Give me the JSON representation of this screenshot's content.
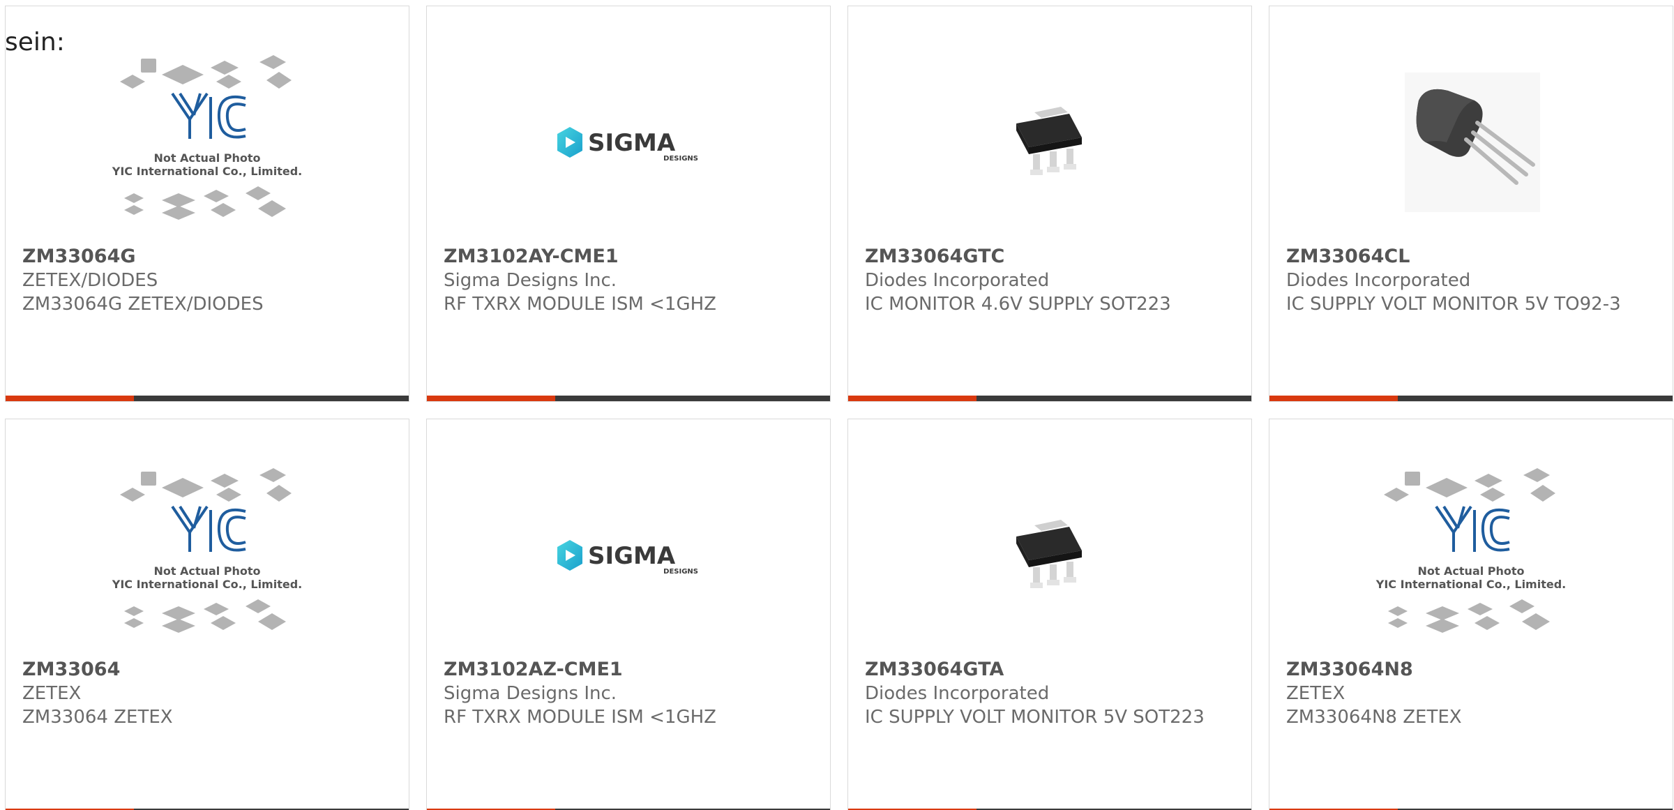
{
  "lead_text": "sein:",
  "accent_color": "#d9390f",
  "cards": [
    {
      "pn": "ZM33064G",
      "mfr": "ZETEX/DIODES",
      "desc": "ZM33064G ZETEX/DIODES",
      "image": "yic-placeholder",
      "img_line1": "Not Actual Photo",
      "img_line2": "YIC International Co., Limited."
    },
    {
      "pn": "ZM3102AY-CME1",
      "mfr": "Sigma Designs Inc.",
      "desc": "RF TXRX MODULE ISM <1GHZ",
      "image": "sigma-logo",
      "logo_main": "SIGMA",
      "logo_sub": "DESIGNS"
    },
    {
      "pn": "ZM33064GTC",
      "mfr": "Diodes Incorporated",
      "desc": "IC MONITOR 4.6V SUPPLY SOT223",
      "image": "sot223-chip"
    },
    {
      "pn": "ZM33064CL",
      "mfr": "Diodes Incorporated",
      "desc": "IC SUPPLY VOLT MONITOR 5V TO92-3",
      "image": "to92-transistor"
    },
    {
      "pn": "ZM33064",
      "mfr": "ZETEX",
      "desc": "ZM33064 ZETEX",
      "image": "yic-placeholder",
      "img_line1": "Not Actual Photo",
      "img_line2": "YIC International Co., Limited."
    },
    {
      "pn": "ZM3102AZ-CME1",
      "mfr": "Sigma Designs Inc.",
      "desc": "RF TXRX MODULE ISM <1GHZ",
      "image": "sigma-logo",
      "logo_main": "SIGMA",
      "logo_sub": "DESIGNS"
    },
    {
      "pn": "ZM33064GTA",
      "mfr": "Diodes Incorporated",
      "desc": "IC SUPPLY VOLT MONITOR 5V SOT223",
      "image": "sot223-chip"
    },
    {
      "pn": "ZM33064N8",
      "mfr": "ZETEX",
      "desc": "ZM33064N8 ZETEX",
      "image": "yic-placeholder",
      "img_line1": "Not Actual Photo",
      "img_line2": "YIC International Co., Limited."
    }
  ]
}
